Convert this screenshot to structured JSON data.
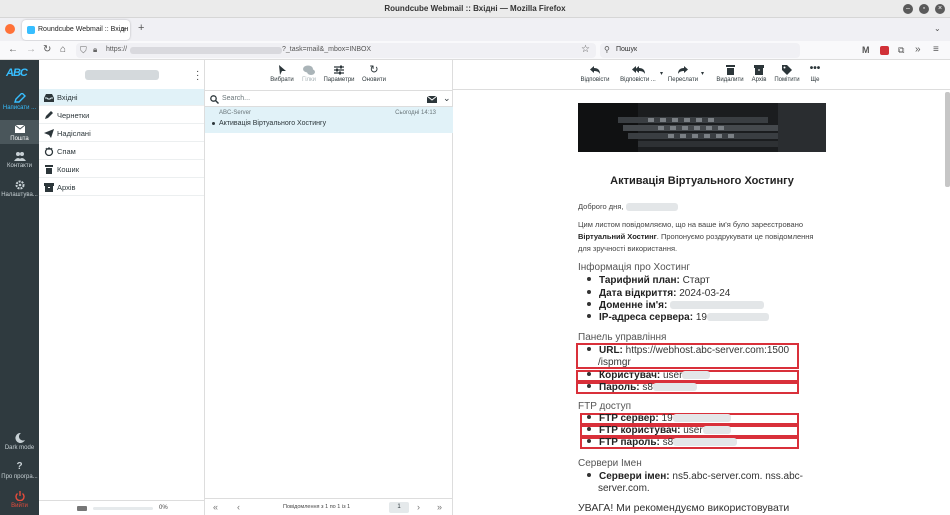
{
  "window": {
    "title": "Roundcube Webmail :: Вхідні — Mozilla Firefox"
  },
  "browser": {
    "tab_title": "Roundcube Webmail :: Вхідн",
    "url_prefix": "https://",
    "url_suffix": "?_task=mail&_mbox=INBOX",
    "search_placeholder": "Пошук"
  },
  "app": {
    "logo": "ABC"
  },
  "nav": {
    "compose": "Написати ...",
    "mail": "Пошта",
    "contacts": "Контакти",
    "settings": "Налаштува...",
    "dark_mode": "Dark mode",
    "about": "Про програ...",
    "logout": "Вийти"
  },
  "folders": [
    "Вхідні",
    "Чернетки",
    "Надіслані",
    "Спам",
    "Кошик",
    "Архів"
  ],
  "quota": {
    "percent": "0%",
    "fill": 0
  },
  "list_toolbar": {
    "select": "Вибрати",
    "threads": "Гілки",
    "options": "Параметри",
    "refresh": "Оновити"
  },
  "list": {
    "search_placeholder": "Search...",
    "message": {
      "from": "ABC-Server",
      "date": "Сьогодні 14:13",
      "subject": "Активація Віртуального Хостингу"
    },
    "pager_text": "Повідомлення з 1 по 1 із 1",
    "page": "1"
  },
  "reader_toolbar": {
    "reply": "Відповісти",
    "reply_all": "Відповісти ...",
    "forward": "Переслати",
    "delete": "Видалити",
    "archive": "Архів",
    "mark": "Помітити",
    "more": "Ще"
  },
  "email": {
    "title": "Активація Віртуального Хостингу",
    "greeting": "Доброго дня,",
    "intro_1": "Цим листом повідомляємо, що на ваше ім'я було зареєстровано",
    "intro_bold": "Віртуальний Хостинг",
    "intro_2": ". Пропонуємо роздрукувати це повідомлення для зручності використання.",
    "hosting_heading": "Інформація про Хостинг",
    "plan_label": "Тарифний план:",
    "plan_value": "Старт",
    "date_label": "Дата відкриття:",
    "date_value": "2024-03-24",
    "domain_label": "Доменне ім'я:",
    "ip_label": "IP-адреса сервера:",
    "ip_value": "19",
    "panel_heading": "Панель управління",
    "url_label": "URL:",
    "url_value": "https://webhost.abc-server.com:1500",
    "url_value2": "/ispmgr",
    "user_label": "Користувач:",
    "user_value": "user",
    "pass_label": "Пароль:",
    "pass_value": "s8",
    "ftp_heading": "FTP доступ",
    "ftp_server_label": "FTP сервер:",
    "ftp_server_value": "19",
    "ftp_user_label": "FTP користувач:",
    "ftp_user_value": "user",
    "ftp_pass_label": "FTP пароль:",
    "ftp_pass_value": "s8",
    "ns_heading": "Сервери Імен",
    "ns_label": "Сервери імен:",
    "ns_value": "ns5.abc-server.com. nss.abc-",
    "ns_value2": "server.com.",
    "warning": "УВАГА! Ми рекомендуємо використовувати"
  },
  "colors": {
    "highlight_box": "#d9303a",
    "nav_bg": "#2f3a3f",
    "selected_bg": "#e1f2f8",
    "accent": "#37beff",
    "logout": "#e74c3c"
  }
}
